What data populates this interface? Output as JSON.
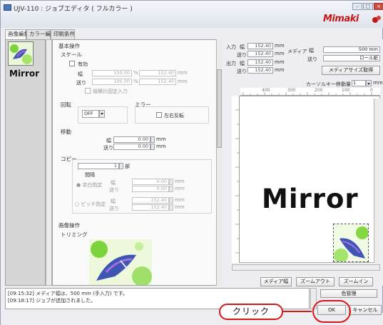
{
  "window": {
    "title": "UJV-110 : ジョブエディタ ( フルカラー )",
    "brand": "Mimaki",
    "buttons": {
      "minimize": "–",
      "maximize": "□",
      "close": "×"
    }
  },
  "tabs": [
    "画像編集",
    "カラー編集",
    "印刷条件"
  ],
  "thumbnail": {
    "label": "Mirror"
  },
  "basic": {
    "header": "基本操作",
    "scale": {
      "title": "スケール",
      "enable_label": "有効",
      "width_label": "幅",
      "width_percent": "100.00",
      "width_mm": "152.40",
      "feed_label": "送り",
      "feed_percent": "100.00",
      "feed_mm": "152.40",
      "percent_unit": "%",
      "mm_unit": "mm",
      "aspect_label": "縦横比固定入力"
    },
    "rotate": {
      "title": "回転",
      "value": "OFF"
    },
    "mirror": {
      "title": "ミラー",
      "flip_label": "左右反転"
    },
    "move": {
      "title": "移動",
      "width_label": "幅",
      "width_value": "0.00",
      "feed_label": "送り",
      "feed_value": "0.00",
      "unit": "mm"
    },
    "copy": {
      "title": "コピー",
      "count": "1",
      "count_unit": "部",
      "spacing_title": "間隔",
      "same_label": "● 余白指定",
      "pitch_label": "○ ピッチ指定",
      "same_width_label": "幅",
      "same_width": "0.00",
      "same_feed_label": "送り",
      "same_feed": "0.00",
      "pitch_width_label": "幅",
      "pitch_width": "152.40",
      "pitch_feed_label": "送り",
      "pitch_feed": "152.40",
      "unit": "mm"
    }
  },
  "image_ops": {
    "header": "画像操作",
    "trimming": "トリミング"
  },
  "right": {
    "input_label": "入力",
    "output_label": "出力",
    "width_label": "幅",
    "feed_label": "送り",
    "input_width": "152.40",
    "input_feed": "152.40",
    "output_width": "152.40",
    "output_feed": "152.40",
    "unit": "mm",
    "media_label": "メディア",
    "media_width_label": "幅",
    "media_feed_label": "送り",
    "media_width": "500 mm",
    "media_feed": "ロール紙",
    "media_size_button": "メディアサイズ取得",
    "cursor_label": "カーソルキー移動量",
    "cursor_value": "1",
    "cursor_unit": "mm",
    "ruler_ticks": [
      "400",
      "300",
      "200",
      "100",
      "0"
    ],
    "canvas_text": "Mirror",
    "bottom_buttons": [
      "メディア幅",
      "ズームアウト",
      "ズームイン"
    ]
  },
  "status": {
    "lines": [
      "[09:15:32] メディア幅は、500 mm (手入力) です。",
      "[09:18:17] ジョブが追加されました。"
    ]
  },
  "footer": {
    "manage_label": "色管理",
    "ok": "OK",
    "cancel": "キャンセル"
  },
  "annotation": {
    "callout": "クリック"
  },
  "colors": {
    "accent": "#d71818",
    "brand": "#c01818"
  }
}
